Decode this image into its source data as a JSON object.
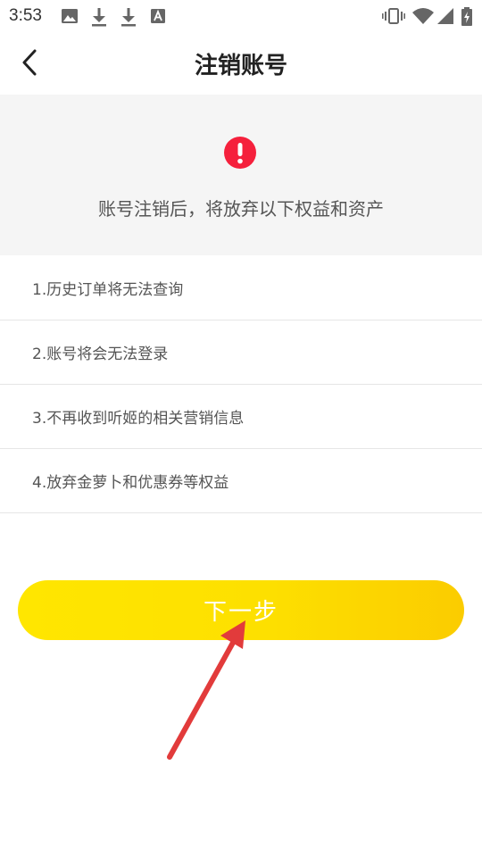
{
  "status_bar": {
    "time": "3:53",
    "left_icons": [
      "image-icon",
      "download-icon",
      "download-icon",
      "a-box-icon"
    ],
    "right_icons": [
      "vibrate-icon",
      "wifi-icon",
      "signal-icon",
      "battery-icon"
    ]
  },
  "nav": {
    "title": "注销账号",
    "back_icon": "chevron-left-icon"
  },
  "warning": {
    "icon": "exclamation-circle-icon",
    "icon_color": "#f5203c",
    "text": "账号注销后，将放弃以下权益和资产"
  },
  "rights": [
    {
      "label": "1.历史订单将无法查询"
    },
    {
      "label": "2.账号将会无法登录"
    },
    {
      "label": "3.不再收到听姬的相关营销信息"
    },
    {
      "label": "4.放弃金萝卜和优惠券等权益"
    }
  ],
  "next_button": {
    "label": "下一步",
    "color_start": "#ffe600",
    "color_end": "#fbcc00"
  },
  "annotation": {
    "arrow_color": "#e23b3b"
  }
}
